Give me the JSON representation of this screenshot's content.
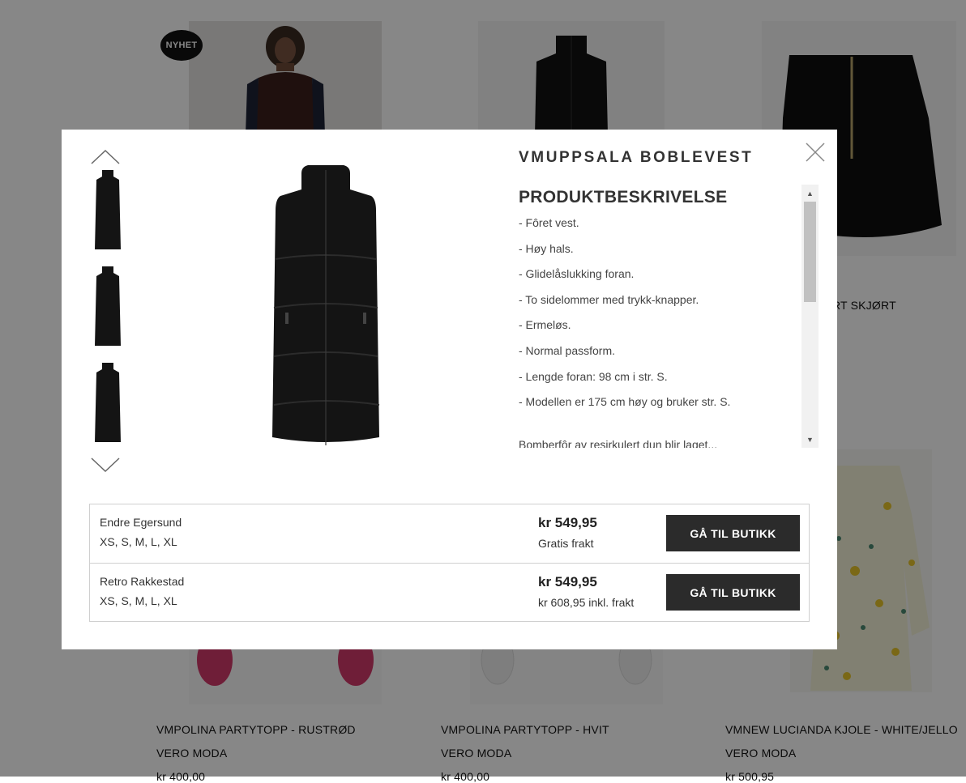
{
  "background": {
    "badge": "NYHET",
    "partial_title": "RT SKJØRT",
    "cards": [
      {
        "title": "VMPOLINA PARTYTOPP - RUSTRØD",
        "brand": "VERO MODA",
        "price": "kr 400,00"
      },
      {
        "title": "VMPOLINA PARTYTOPP - HVIT",
        "brand": "VERO MODA",
        "price": "kr 400,00"
      },
      {
        "title": "VMNEW LUCIANDA KJOLE - WHITE/JELLO",
        "brand": "VERO MODA",
        "price": "kr 500,95"
      }
    ]
  },
  "modal": {
    "product_title": "VMUPPSALA BOBLEVEST",
    "description": {
      "heading": "PRODUKTBESKRIVELSE",
      "lines": [
        "- Fôret vest.",
        "- Høy hals.",
        "- Glidelåslukking foran.",
        "- To sidelommer med trykk-knapper.",
        "- Ermeløs.",
        "- Normal passform.",
        "- Lengde foran: 98 cm i str. S.",
        "- Modellen er 175 cm høy og bruker str. S."
      ],
      "extra": "Bomberfôr av resirkulert dun blir laget..."
    },
    "offers": [
      {
        "store": "Endre Egersund",
        "sizes": "XS, S, M, L, XL",
        "price": "kr 549,95",
        "shipping": "Gratis frakt",
        "button": "GÅ TIL BUTIKK"
      },
      {
        "store": "Retro Rakkestad",
        "sizes": "XS, S, M, L, XL",
        "price": "kr 549,95",
        "shipping": "kr 608,95 inkl. frakt",
        "button": "GÅ TIL BUTIKK"
      }
    ]
  },
  "colors": {
    "overlay": "rgba(0,0,0,0.47)",
    "button_bg": "#2b2b2b",
    "vest": "#141414"
  }
}
